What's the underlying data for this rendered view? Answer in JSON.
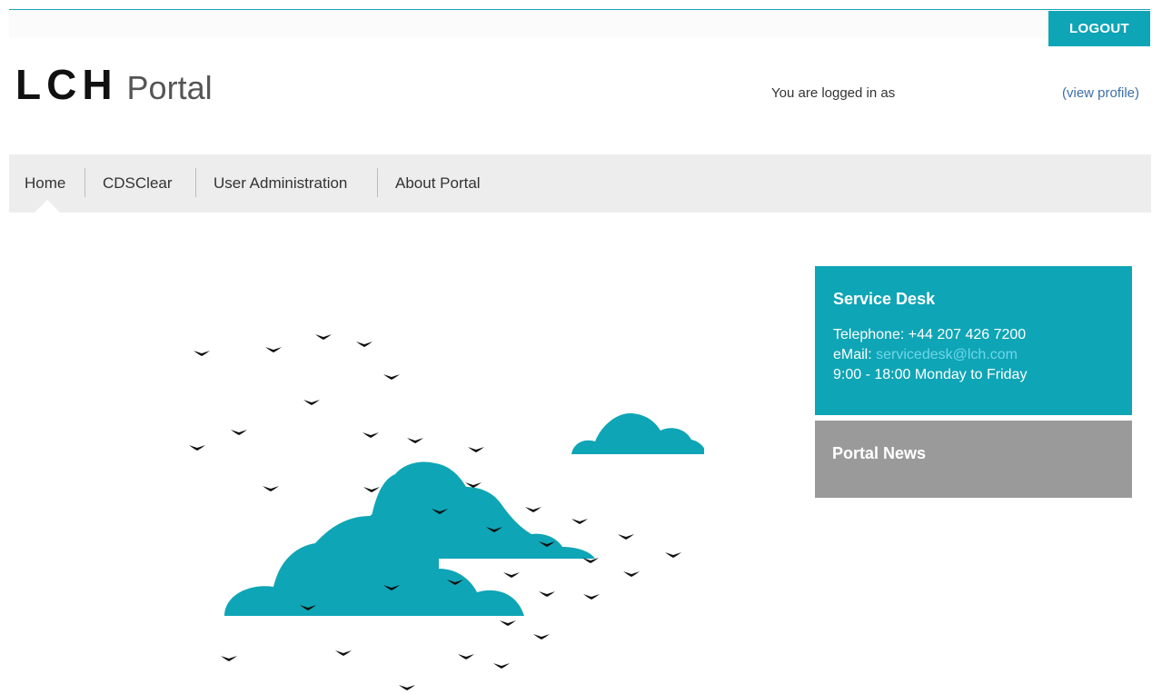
{
  "header": {
    "logout_label": "LOGOUT",
    "logo_mark": "LCH",
    "logo_text": "Portal",
    "logged_in_text": "You are logged in as",
    "view_profile_label": "(view profile)"
  },
  "nav": {
    "items": [
      {
        "label": "Home",
        "active": true
      },
      {
        "label": "CDSClear",
        "active": false
      },
      {
        "label": "User Administration",
        "active": false
      },
      {
        "label": "About Portal",
        "active": false
      }
    ]
  },
  "service_desk": {
    "title": "Service Desk",
    "telephone": "Telephone: +44 207 426 7200",
    "email_label": "eMail:",
    "email": "servicedesk@lch.com",
    "hours": "9:00 - 18:00 Monday to Friday"
  },
  "portal_news": {
    "title": "Portal News"
  },
  "hero": {
    "icon": "clouds-and-birds-illustration"
  },
  "colors": {
    "accent": "#0ea5b6",
    "nav_bg": "#ededed",
    "news_bg": "#9a9a9a",
    "link": "#3d6fa8",
    "bird": "#111111"
  }
}
